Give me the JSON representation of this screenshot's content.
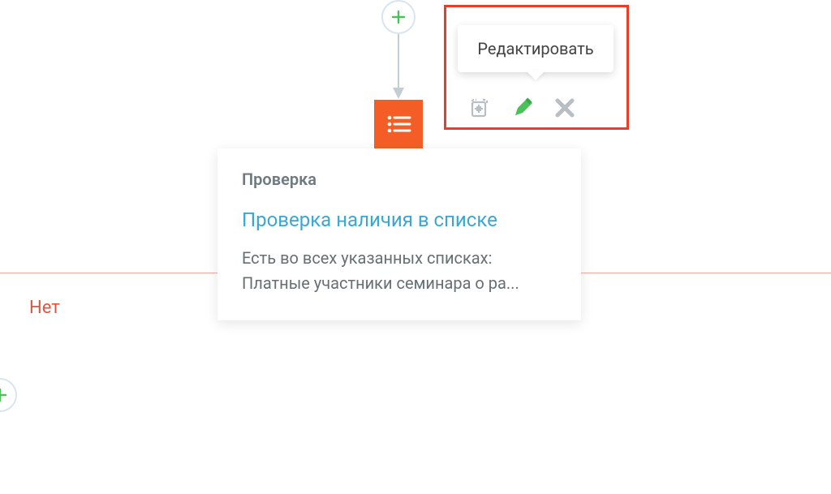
{
  "tooltip": {
    "label": "Редактировать"
  },
  "actions": {
    "copy_name": "copy-icon",
    "edit_name": "edit-icon",
    "delete_name": "delete-icon"
  },
  "card": {
    "type_label": "Проверка",
    "title": "Проверка наличия в списке",
    "desc_line1": "Есть во всех указанных списках:",
    "desc_line2": "Платные участники семинара о ра..."
  },
  "branches": {
    "no_label": "Нет"
  },
  "colors": {
    "accent_orange": "#f45e26",
    "accent_blue": "#39a7d1",
    "accent_green": "#4cc159",
    "highlight_red": "#ec3b26",
    "branch_red": "#e2533f"
  }
}
